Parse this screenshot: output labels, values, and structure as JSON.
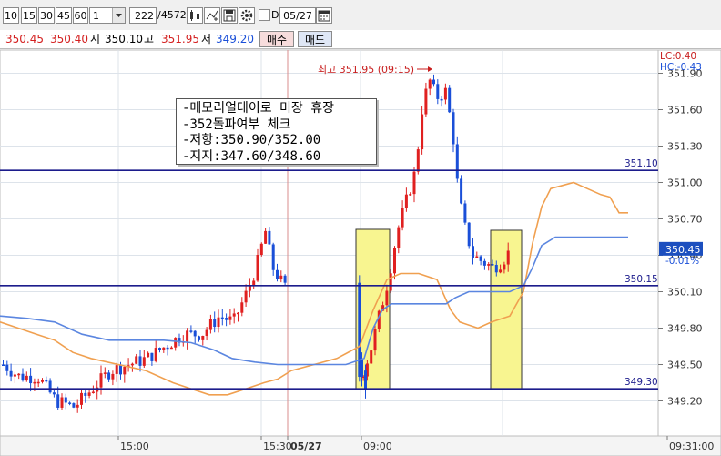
{
  "toolbar": {
    "intervals": [
      "10",
      "15",
      "30",
      "45",
      "60"
    ],
    "multiplier": "1",
    "count": "222",
    "total": "/4572",
    "d_label": "D",
    "date": "05/27"
  },
  "quote": {
    "v1": "350.45",
    "v2": "350.40",
    "open_label": "시",
    "open": "350.10",
    "high_label": "고",
    "high": "351.95",
    "low_label": "저",
    "low": "349.20",
    "buy_label": "매수",
    "sell_label": "매도"
  },
  "memo": {
    "lines": [
      "-메모리얼데이로 미장 휴장",
      "-352돌파여부 체크",
      "-저항:350.90/352.00",
      "-지지:347.60/348.60"
    ]
  },
  "chart_data": {
    "type": "candlestick",
    "y_axis_labels": [
      "351.90",
      "351.60",
      "351.30",
      "351.00",
      "350.70",
      "350.40",
      "350.10",
      "349.80",
      "349.50",
      "349.20"
    ],
    "x_axis_labels": [
      "15:00",
      "15:30",
      "05/27",
      "09:00",
      "09:31:00"
    ],
    "hlines": [
      {
        "label": "351.10",
        "value": 351.1
      },
      {
        "label": "350.15",
        "value": 350.15
      },
      {
        "label": "349.30",
        "value": 349.3
      }
    ],
    "high_note": "최고 351.95 (09:15)",
    "lc": "LC:0.40",
    "hc": "HC:-0.43",
    "current_price": "350.45",
    "current_change": "-0.01%",
    "colors": {
      "up": "#e02020",
      "down": "#1a4fd8",
      "line_orange": "#f0a050",
      "line_blue": "#5b86e0",
      "hline": "#1c1c8c",
      "highlight": "#f8f590"
    }
  }
}
